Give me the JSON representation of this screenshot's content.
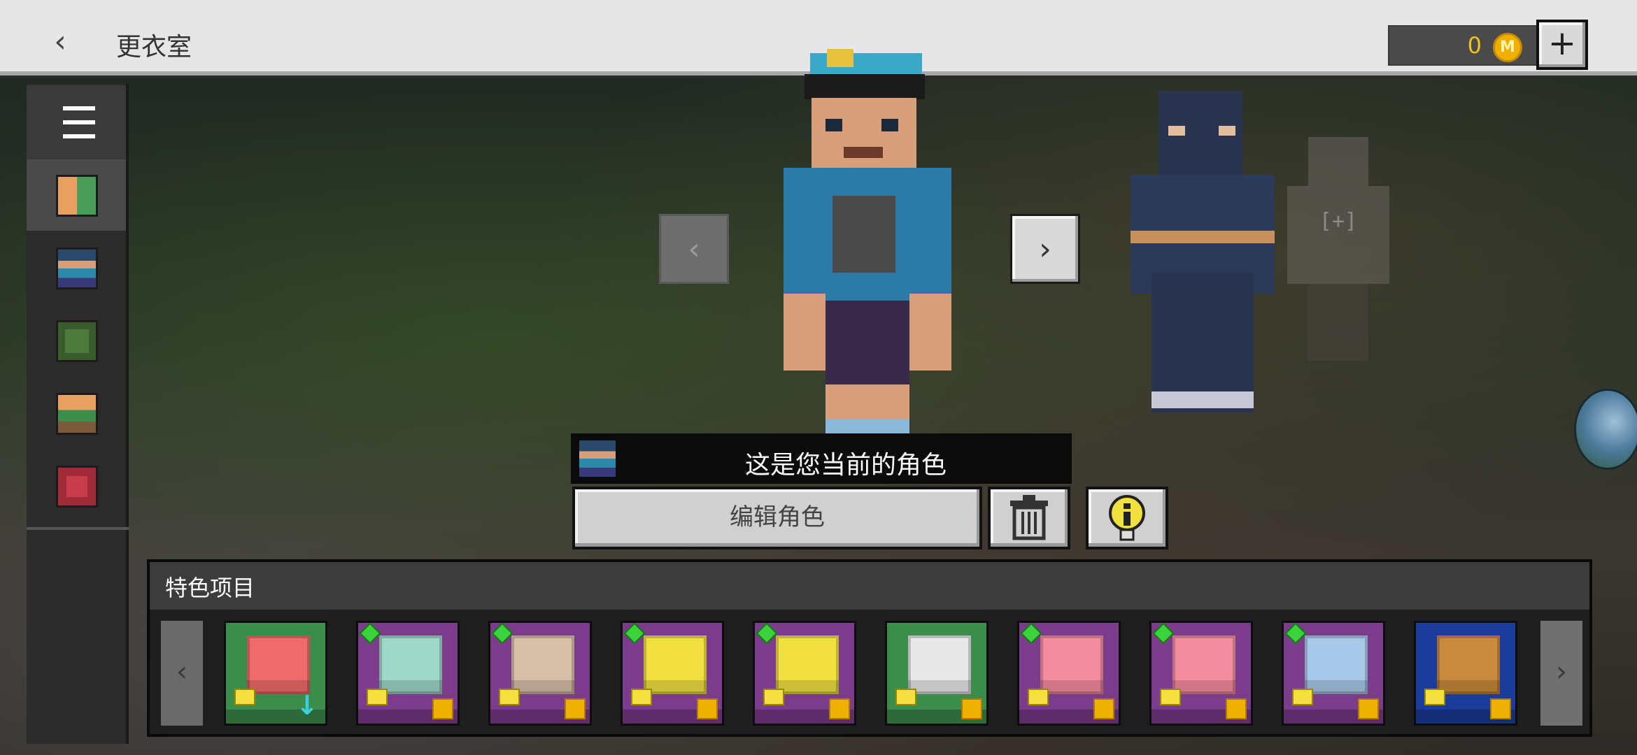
{
  "header": {
    "title": "更衣室",
    "back_icon": "‹",
    "coin_amount": "0",
    "coin_symbol": "M",
    "add_icon": "+"
  },
  "sidebar": {
    "menu_icon": "hamburger-menu-icon",
    "items": [
      {
        "name": "classic-skins",
        "active": true
      },
      {
        "name": "current-character",
        "active": false
      },
      {
        "name": "outfits",
        "active": false
      },
      {
        "name": "steve-alex",
        "active": false
      },
      {
        "name": "emotes",
        "active": false
      }
    ]
  },
  "character": {
    "prev_icon": "‹",
    "next_icon": "›",
    "banner_text": "这是您当前的角色",
    "edit_label": "编辑角色",
    "side_plus_label": "[+]"
  },
  "featured": {
    "title": "特色项目",
    "prev_icon": "‹",
    "next_icon": "›",
    "tiles": [
      {
        "bg": "#3c8c4c",
        "head": "#ef6b6b",
        "gem": false,
        "download": true
      },
      {
        "bg": "#7c3c8c",
        "head": "#9fd8c8",
        "gem": true,
        "download": false
      },
      {
        "bg": "#7c3c8c",
        "head": "#d8c0a8",
        "gem": true,
        "download": false
      },
      {
        "bg": "#7c3c8c",
        "head": "#f0e040",
        "gem": true,
        "download": false
      },
      {
        "bg": "#7c3c8c",
        "head": "#f0e040",
        "gem": true,
        "download": false
      },
      {
        "bg": "#3c8c4c",
        "head": "#e8e8e8",
        "gem": false,
        "download": false
      },
      {
        "bg": "#7c3c8c",
        "head": "#f48ca0",
        "gem": true,
        "download": false
      },
      {
        "bg": "#7c3c8c",
        "head": "#f48ca0",
        "gem": true,
        "download": false
      },
      {
        "bg": "#7c3c8c",
        "head": "#a8c8e8",
        "gem": true,
        "download": false
      },
      {
        "bg": "#1c3c9c",
        "head": "#c88a3c",
        "gem": false,
        "download": false
      }
    ]
  }
}
